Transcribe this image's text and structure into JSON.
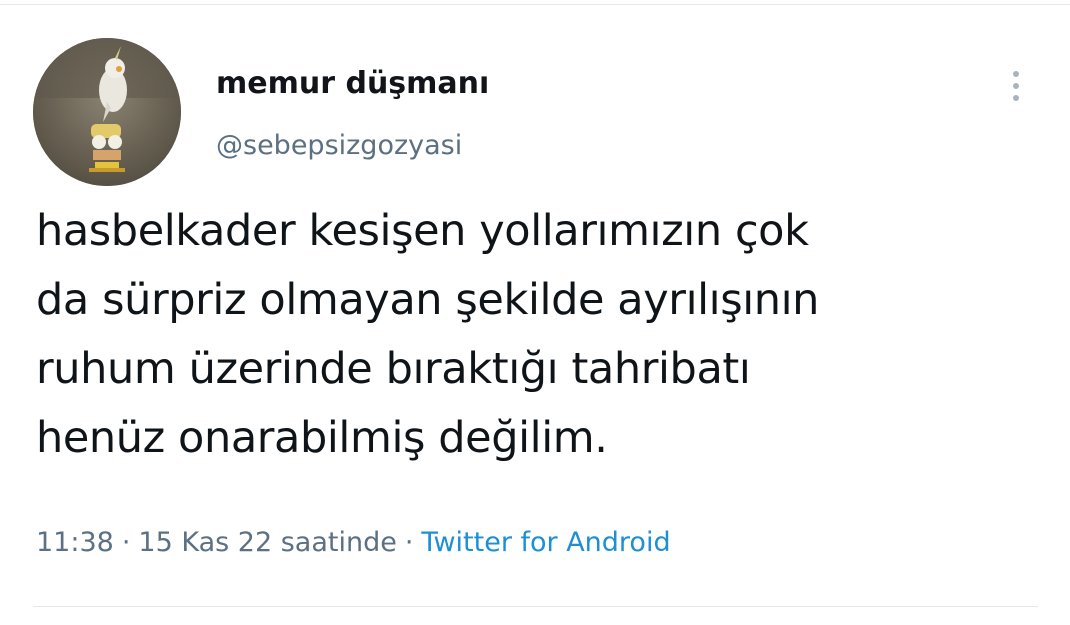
{
  "author": {
    "display_name": "memur düşmanı",
    "handle": "@sebepsizgozyasi",
    "avatar_icon": "cockatiel-avatar-photo"
  },
  "tweet": {
    "text_lines": [
      "hasbelkader kesişen yollarımızın çok",
      "da sürpriz olmayan şekilde ayrılışının",
      "ruhum üzerinde bıraktığı tahribatı",
      "henüz onarabilmiş değilim."
    ]
  },
  "meta": {
    "time": "11:38",
    "separator": "·",
    "date": "15 Kas 22 saatinde",
    "source": "Twitter for Android"
  },
  "menu": {
    "icon": "more-vertical-icon"
  },
  "colors": {
    "text": "#0f1419",
    "secondary": "#5b7083",
    "link": "#1d8fd6",
    "divider": "#e6e9ec"
  }
}
